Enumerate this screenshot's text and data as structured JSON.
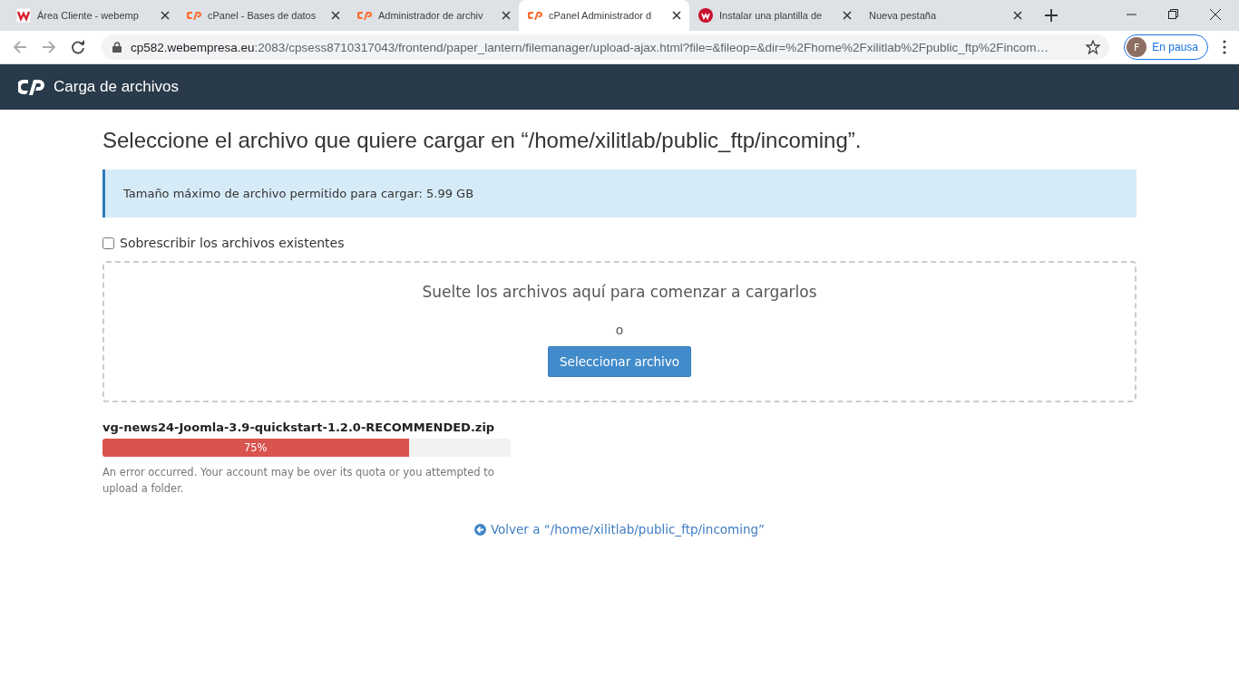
{
  "browser": {
    "tabs": [
      {
        "title": "Área Cliente - webemp",
        "kind": "square",
        "selected": false
      },
      {
        "title": "cPanel - Bases de datos",
        "kind": "cpanel",
        "selected": false
      },
      {
        "title": "Administrador de archiv",
        "kind": "cpanel",
        "selected": false
      },
      {
        "title": "cPanel Administrador d",
        "kind": "cpanel",
        "selected": true
      },
      {
        "title": "Instalar una plantilla de",
        "kind": "round",
        "selected": false
      },
      {
        "title": "Nueva pestaña",
        "kind": "blank",
        "selected": false
      }
    ],
    "address": {
      "host": "cp582.webempresa.eu",
      "path": ":2083/cpsess8710317043/frontend/paper_lantern/filemanager/upload-ajax.html?file=&fileop=&dir=%2Fhome%2Fxilitlab%2Fpublic_ftp%2Fincom…"
    },
    "profile": {
      "initial": "F",
      "label": "En pausa"
    }
  },
  "header": {
    "title": "Carga de archivos"
  },
  "heading": "Seleccione el archivo que quiere cargar en “/home/xilitlab/public_ftp/incoming”.",
  "info": "Tamaño máximo de archivo permitido para cargar: 5.99 GB",
  "overwrite": {
    "label": "Sobrescribir los archivos existentes",
    "checked": false
  },
  "dropzone": {
    "text": "Suelte los archivos aquí para comenzar a cargarlos",
    "or": "o",
    "button": "Seleccionar archivo"
  },
  "uploads": [
    {
      "name": "vg-news24-Joomla-3.9-quickstart-1.2.0-RECOMMENDED.zip",
      "level": 0.75,
      "percent": "75%",
      "error": true,
      "message": "An error occurred. Your account may be over its quota or you attempted to upload a folder."
    }
  ],
  "back_link": "Volver a “/home/xilitlab/public_ftp/incoming”"
}
